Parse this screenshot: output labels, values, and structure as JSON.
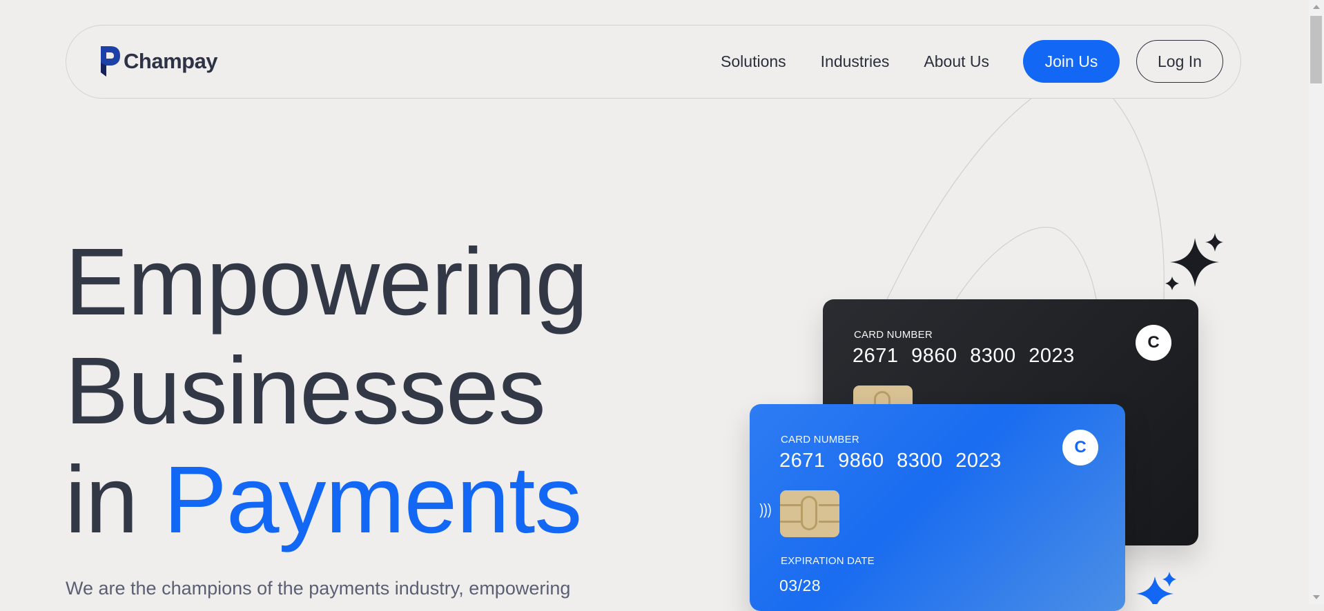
{
  "brand": {
    "name": "Champay"
  },
  "nav": {
    "links": [
      "Solutions",
      "Industries",
      "About Us"
    ],
    "join_label": "Join Us",
    "login_label": "Log In"
  },
  "hero": {
    "line1": "Empowering",
    "line2": "Businesses",
    "line3_prefix": "in",
    "line3_accent": "Payments",
    "subtitle": "We are the champions of the payments industry, empowering"
  },
  "cards": {
    "black": {
      "number_label": "CARD NUMBER",
      "number": "2671 9860 8300 2023",
      "logo_letter": "C"
    },
    "blue": {
      "number_label": "CARD NUMBER",
      "number": "2671 9860 8300 2023",
      "logo_letter": "C",
      "expiry_label": "EXPIRATION DATE",
      "expiry": "03/28"
    }
  },
  "colors": {
    "accent": "#1267f5",
    "background": "#efeeed",
    "text": "#333847"
  }
}
